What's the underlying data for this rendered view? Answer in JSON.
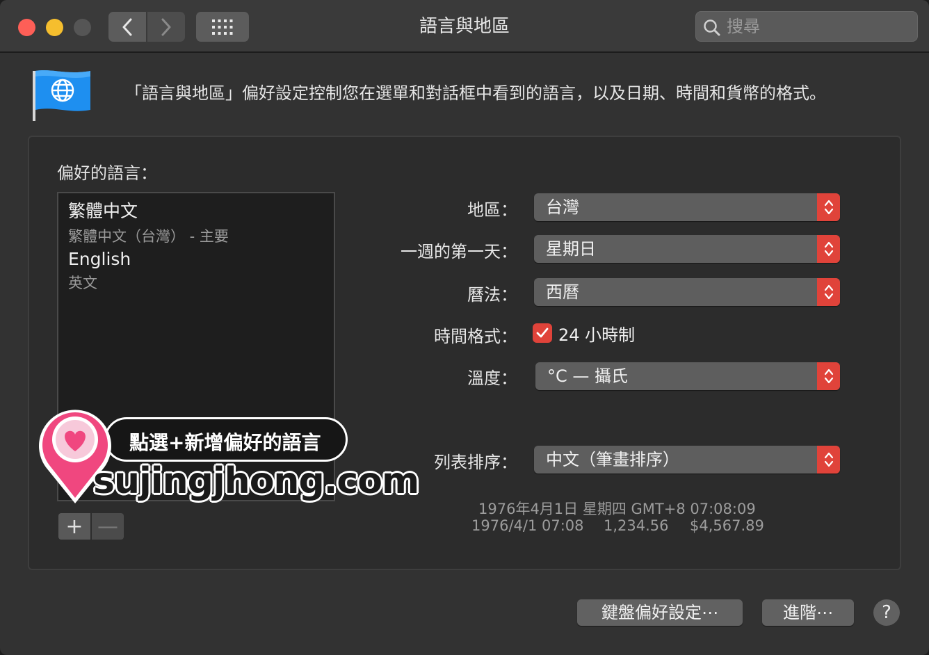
{
  "window": {
    "title": "語言與地區"
  },
  "toolbar": {
    "back_icon": "chevron-left-icon",
    "forward_icon": "chevron-right-icon",
    "show_all_icon": "grid-icon",
    "search_placeholder": "搜尋",
    "search_value": ""
  },
  "header": {
    "icon": "globe-flag-icon",
    "description": "「語言與地區」偏好設定控制您在選單和對話框中看到的語言，以及日期、時間和貨幣的格式。"
  },
  "preferred_languages": {
    "label": "偏好的語言：",
    "items": [
      {
        "name": "繁體中文",
        "detail": "繁體中文（台灣） - 主要"
      },
      {
        "name": "English",
        "detail": "英文"
      }
    ],
    "add_label": "+",
    "remove_label": "—"
  },
  "settings": {
    "region": {
      "label": "地區：",
      "value": "台灣"
    },
    "first_day": {
      "label": "一週的第一天：",
      "value": "星期日"
    },
    "calendar": {
      "label": "曆法：",
      "value": "西曆"
    },
    "time_format": {
      "label": "時間格式：",
      "checkbox_label": "24 小時制",
      "checked": true
    },
    "temperature": {
      "label": "溫度：",
      "value": "°C — 攝氏"
    },
    "list_sort": {
      "label": "列表排序：",
      "value": "中文（筆畫排序）"
    }
  },
  "sample": {
    "line1": "1976年4月1日 星期四 GMT+8 07:08:09",
    "date_short": "1976/4/1 07:08",
    "number": "1,234.56",
    "currency": "$4,567.89"
  },
  "buttons": {
    "keyboard_prefs": "鍵盤偏好設定⋯",
    "advanced": "進階⋯",
    "help": "?"
  },
  "watermark": {
    "caption": "點選+新增偏好的語言",
    "site": "sujingjhong.com"
  },
  "colors": {
    "accent": "#e0433a",
    "close": "#fe5f57",
    "minimize": "#f5be2e",
    "zoom_disabled": "#555555",
    "watermark_pink": "#f0477f"
  }
}
